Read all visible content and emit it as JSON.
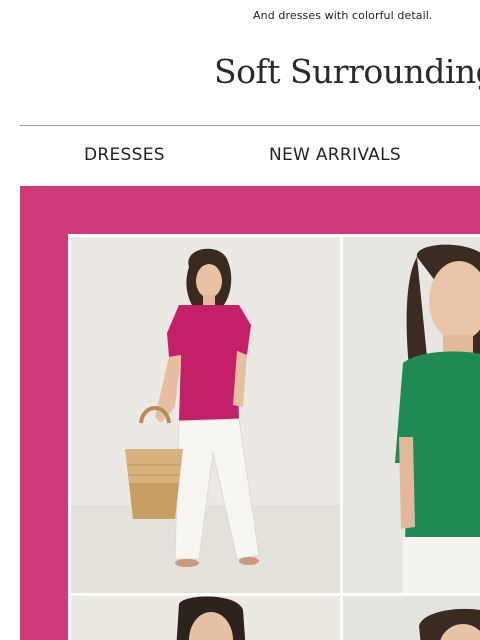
{
  "preheader": {
    "text": "And dresses with colorful detail."
  },
  "brand": {
    "logo_text": "Soft Surroundings"
  },
  "nav": {
    "items": [
      {
        "label": "DRESSES"
      },
      {
        "label": "NEW ARRIVALS"
      }
    ]
  },
  "hero": {
    "background_color": "#cf3b78",
    "photos": [
      {
        "subject": "model-magenta-top"
      },
      {
        "subject": "model-green-top"
      },
      {
        "subject": "model-portrait-bottom-left"
      },
      {
        "subject": "model-portrait-bottom-right"
      }
    ]
  },
  "colors": {
    "accent_pink": "#cf3b78",
    "top_magenta": "#c4206a",
    "top_green": "#1e8a56",
    "divider": "#9a9a9a",
    "text": "#222222"
  }
}
